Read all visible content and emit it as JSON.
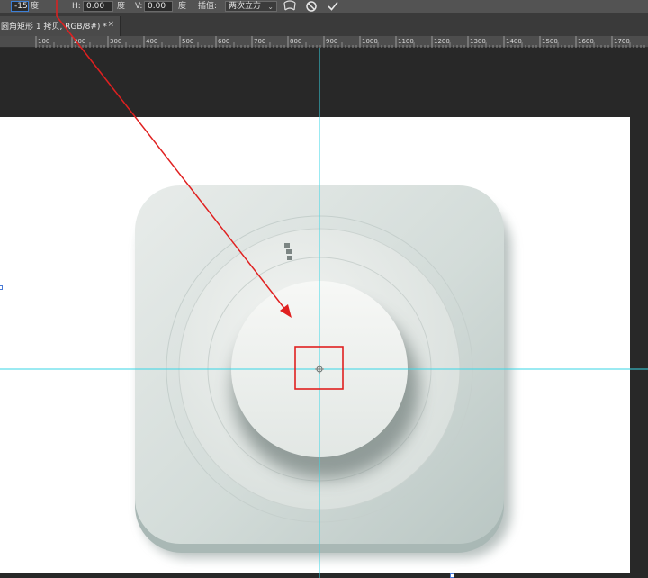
{
  "options_bar": {
    "angle_value": "-15",
    "angle_unit": "度",
    "h_label": "H:",
    "h_value": "0.00",
    "h_unit": "度",
    "v_label": "V:",
    "v_value": "0.00",
    "v_unit": "度",
    "interpolation_label": "插值:",
    "interpolation_value": "两次立方"
  },
  "document_tab": {
    "title": "圆角矩形 1 拷贝, RGB/8#) *",
    "close": "×"
  },
  "ruler": {
    "labels": [
      "100",
      "200",
      "300",
      "400",
      "500",
      "600",
      "700",
      "800",
      "900",
      "1000",
      "1100",
      "1200",
      "1300",
      "1400",
      "1500",
      "1600",
      "1700"
    ]
  },
  "colors": {
    "guide": "#37d6e6",
    "annotation": "#e02020",
    "icon_face": "#d4dcd9"
  },
  "icons": {
    "cancel": "cancel-transform-icon",
    "commit": "commit-transform-icon",
    "warp": "warp-mode-icon",
    "pivot": "pivot-point-icon"
  }
}
